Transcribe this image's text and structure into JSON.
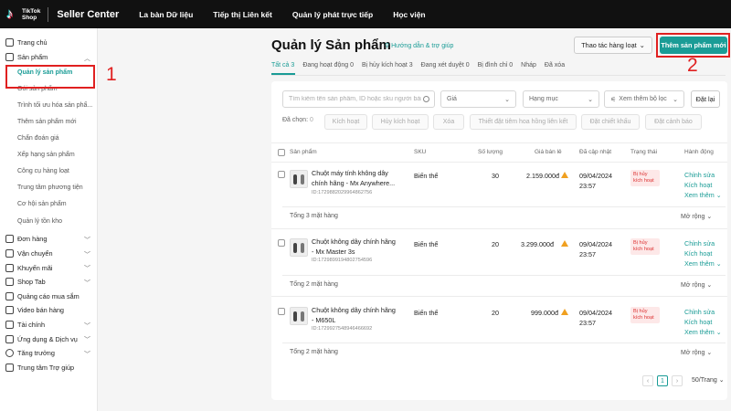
{
  "topbar": {
    "logo_line1": "TikTok",
    "logo_line2": "Shop",
    "app_title": "Seller Center",
    "nav": [
      "La bàn Dữ liệu",
      "Tiếp thị Liên kết",
      "Quản lý phát trực tiếp",
      "Học viện"
    ]
  },
  "sidebar": {
    "home": "Trang chủ",
    "products": "Sản phẩm",
    "product_sub": [
      "Quản lý sản phẩm",
      "Gói sản phẩm",
      "Trình tối ưu hóa sản phẩ...",
      "Thêm sản phẩm mới",
      "Chẩn đoán giá",
      "Xếp hạng sản phẩm",
      "Công cụ hàng loạt",
      "Trung tâm phương tiện",
      "Cơ hội sản phẩm",
      "Quản lý tồn kho"
    ],
    "sections": [
      "Đơn hàng",
      "Vận chuyển",
      "Khuyến mãi",
      "Shop Tab",
      "Quảng cáo mua sắm",
      "Video bán hàng",
      "Tài chính",
      "Ứng dụng & Dịch vụ",
      "Tăng trưởng",
      "Trung tâm Trợ giúp"
    ]
  },
  "annotations": {
    "one": "1",
    "two": "2"
  },
  "header": {
    "title": "Quản lý Sản phẩm",
    "guide": "Hướng dẫn & trợ giúp",
    "bulk_btn": "Thao tác hàng loạt",
    "add_btn": "Thêm sản phẩm mới"
  },
  "tabs": [
    {
      "label": "Tất cả",
      "count": "3"
    },
    {
      "label": "Đang hoạt động",
      "count": "0"
    },
    {
      "label": "Bị hủy kích hoạt",
      "count": "3"
    },
    {
      "label": "Đang xét duyệt",
      "count": "0"
    },
    {
      "label": "Bị đình chỉ",
      "count": "0"
    },
    {
      "label": "Nháp",
      "count": ""
    },
    {
      "label": "Đã xóa",
      "count": ""
    }
  ],
  "filters": {
    "search_placeholder": "Tìm kiếm tên sản phẩm, ID hoặc sku người bán",
    "price": "Giá",
    "category": "Hạng mục",
    "more": "Xem thêm bộ lọc",
    "reset": "Đặt lại"
  },
  "bulk_actions": {
    "selected": "Đã chọn:",
    "selected_count": "0",
    "items": [
      "Kích hoạt",
      "Hủy kích hoạt",
      "Xóa",
      "Thiết đặt tiêm hoa hồng liên kết",
      "Đặt chiết khấu",
      "Đặt cảnh báo"
    ]
  },
  "table": {
    "headers": [
      "Sản phẩm",
      "SKU",
      "Số lượng",
      "Giá bán lẻ",
      "Đã cập nhật",
      "Trạng thái",
      "Hành động"
    ],
    "rows": [
      {
        "name": "Chuột máy tính không dây chính hãng - Mx Anywhere...",
        "id": "ID:1729882029964862756",
        "sku": "Biến thể",
        "qty": "30",
        "price": "2.159.000đ",
        "date": "09/04/2024",
        "time": "23:57",
        "status": "Bị hủy kích hoạt",
        "actions": [
          "Chỉnh sửa",
          "Kích hoạt",
          "Xem thêm"
        ],
        "total": "Tổng 3 mặt hàng",
        "expand": "Mở rộng"
      },
      {
        "name": "Chuột không dây chính hãng - Mx Master 3s",
        "id": "ID:1729899194802754596",
        "sku": "Biến thể",
        "qty": "20",
        "price": "3.299.000đ",
        "date": "09/04/2024",
        "time": "23:57",
        "status": "Bị hủy kích hoạt",
        "actions": [
          "Chỉnh sửa",
          "Kích hoạt",
          "Xem thêm"
        ],
        "total": "Tổng 2 mặt hàng",
        "expand": "Mở rộng"
      },
      {
        "name": "Chuột không dây chính hãng - M650L",
        "id": "ID:1729927548946466692",
        "sku": "Biến thể",
        "qty": "20",
        "price": "999.000đ",
        "date": "09/04/2024",
        "time": "23:57",
        "status": "Bị hủy kích hoạt",
        "actions": [
          "Chỉnh sửa",
          "Kích hoạt",
          "Xem thêm"
        ],
        "total": "Tổng 2 mặt hàng",
        "expand": "Mở rộng"
      }
    ]
  },
  "pager": {
    "current": "1",
    "per_page": "50/Trang"
  },
  "colors": {
    "accent": "#1a9c96",
    "annotation": "#e02020",
    "topbar": "#111111"
  }
}
